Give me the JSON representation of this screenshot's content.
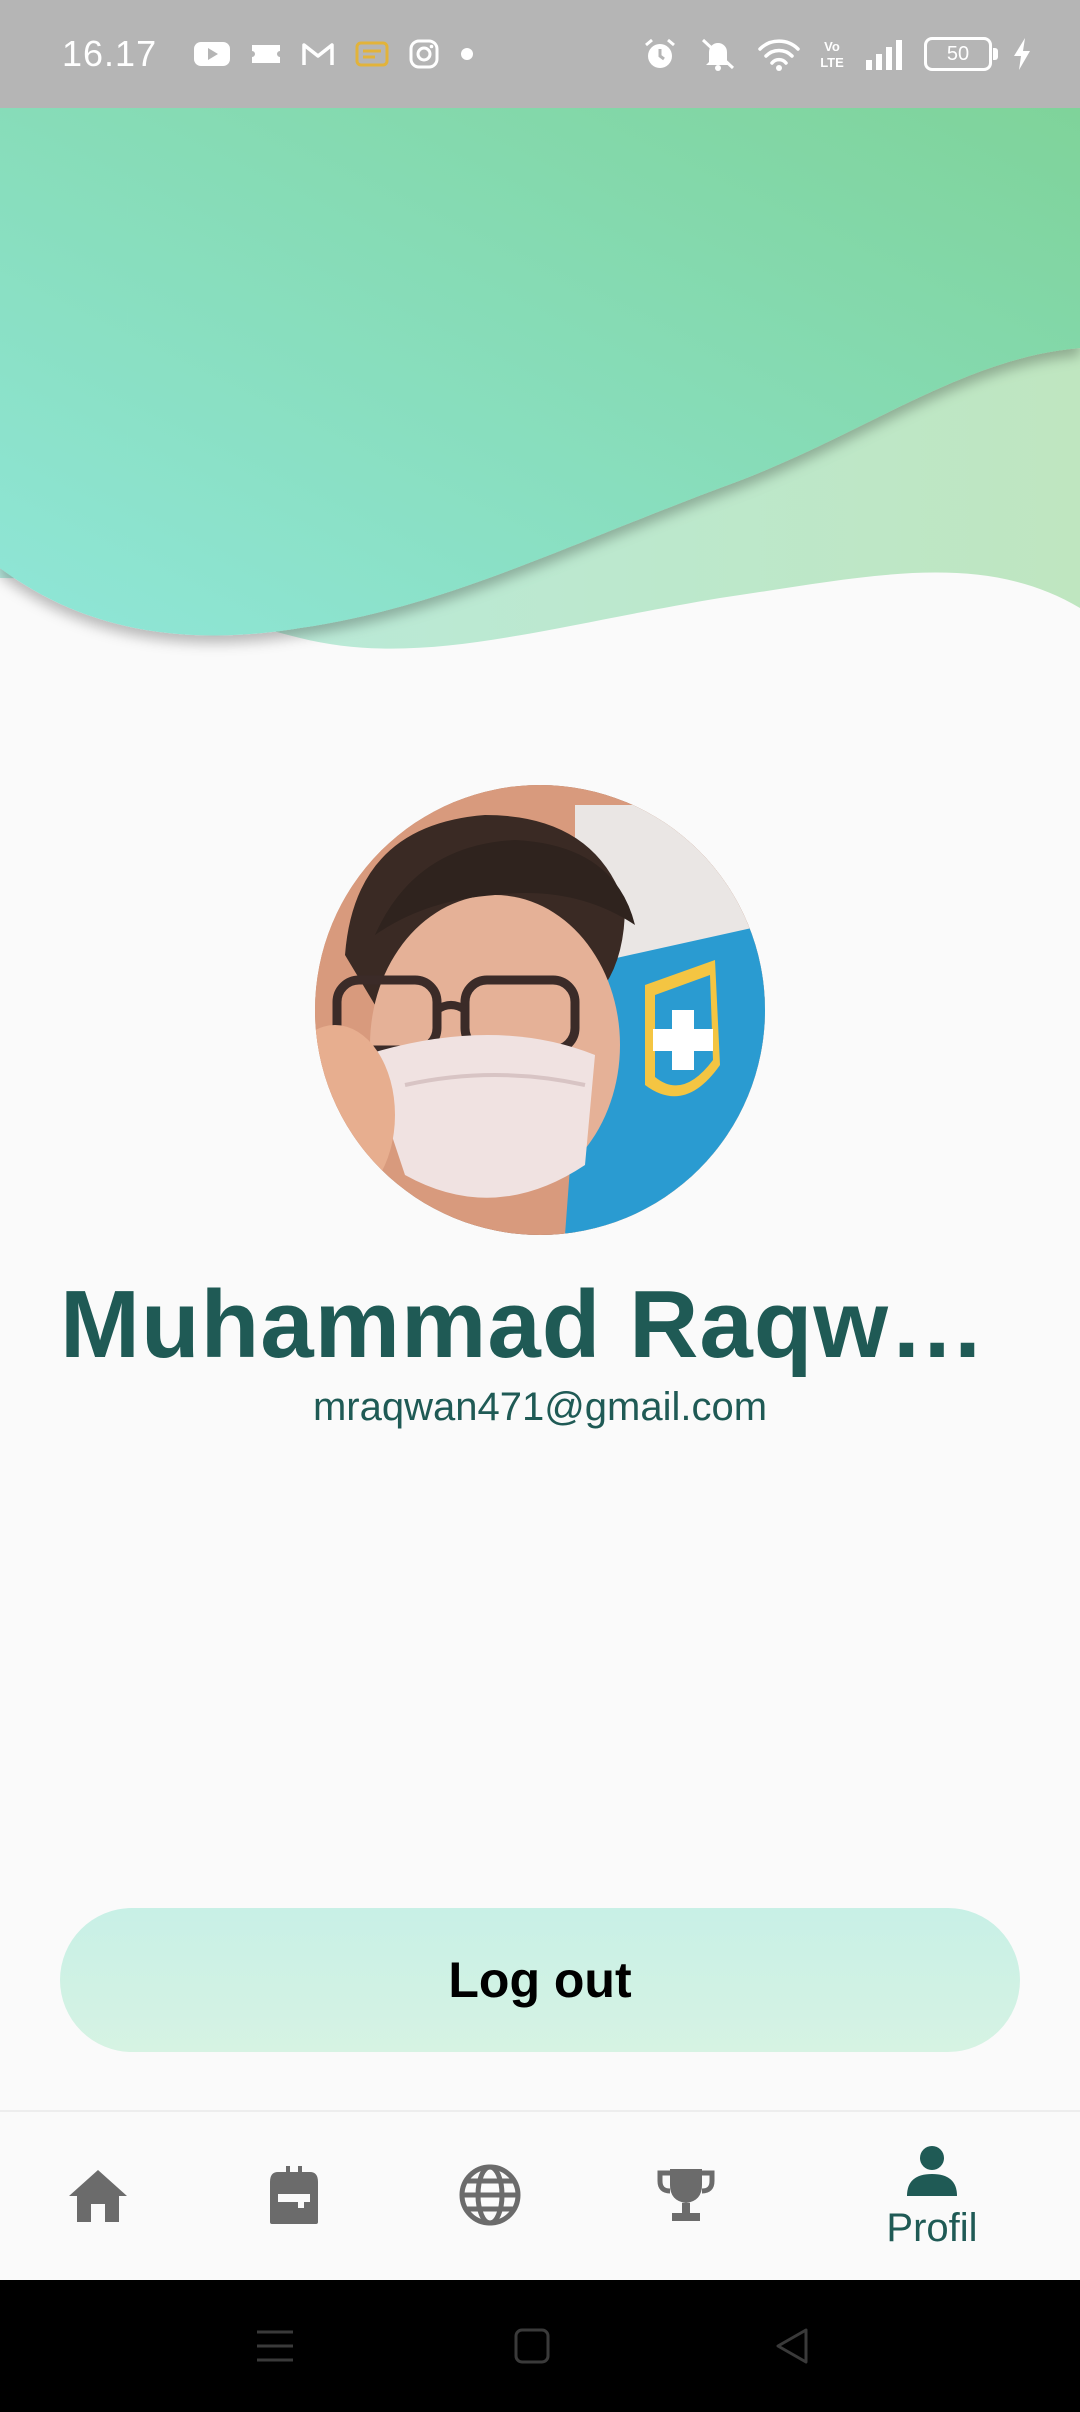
{
  "status_bar": {
    "time": "16.17",
    "left_icons": [
      "youtube-icon",
      "ticket-icon",
      "gmail-icon",
      "app-icon",
      "instagram-icon",
      "dot-icon"
    ],
    "right_icons": [
      "alarm-icon",
      "mute-icon",
      "wifi-icon",
      "volte-icon",
      "signal-icon"
    ],
    "battery": "50"
  },
  "colors": {
    "header_gradient_start": "#8fe6d8",
    "header_gradient_end": "#7fd39a",
    "accent": "#1f5a55",
    "button_bg": "#c8f0e6",
    "nav_icon": "#6b6b6b"
  },
  "profile": {
    "name": "Muhammad Raqwan…",
    "email": "mraqwan471@gmail.com"
  },
  "logout": {
    "label": "Log out"
  },
  "bottom_nav": {
    "items": [
      {
        "icon": "home-icon",
        "label": ""
      },
      {
        "icon": "backpack-icon",
        "label": ""
      },
      {
        "icon": "globe-icon",
        "label": ""
      },
      {
        "icon": "trophy-icon",
        "label": ""
      },
      {
        "icon": "person-icon",
        "label": "Profil",
        "active": true
      }
    ]
  },
  "system_nav": [
    "menu-icon",
    "home-square-icon",
    "back-icon"
  ]
}
